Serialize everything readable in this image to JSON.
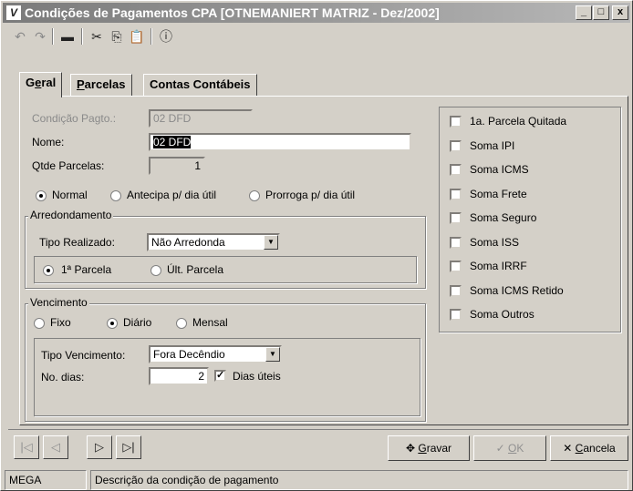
{
  "window": {
    "title": "Condições de Pagamentos CPA [OTNEMANIERT MATRIZ - Dez/2002]",
    "app_icon": "V",
    "min_icon": "_",
    "max_icon": "□",
    "close_icon": "x"
  },
  "toolbar": {
    "undo_icon": "↶",
    "redo_icon": "↷",
    "delete_icon": "▬",
    "cut_icon": "✂",
    "copy_icon": "⎘",
    "paste_icon": "📋",
    "info_icon": "ⓘ"
  },
  "tabs": {
    "geral_pre": "G",
    "geral_u": "e",
    "geral_post": "ral",
    "parcelas_u": "P",
    "parcelas_post": "arcelas",
    "contas": "Contas Contábeis"
  },
  "form": {
    "condicao_label": "Condição Pagto.:",
    "condicao_value": "02 DFD",
    "nome_label": "Nome:",
    "nome_value": "02 DFD",
    "qtde_label": "Qtde Parcelas:",
    "qtde_value": "1",
    "radio_normal": "Normal",
    "radio_antecipa": "Antecipa p/ dia útil",
    "radio_prorroga": "Prorroga p/ dia útil"
  },
  "arredondamento": {
    "title": "Arredondamento",
    "tipo_label": "Tipo Realizado:",
    "tipo_value": "Não Arredonda",
    "radio_primeira": "1ª Parcela",
    "radio_ultima": "Últ. Parcela"
  },
  "vencimento": {
    "title": "Vencimento",
    "radio_fixo": "Fixo",
    "radio_diario": "Diário",
    "radio_mensal": "Mensal",
    "tipo_label": "Tipo Vencimento:",
    "tipo_value": "Fora Decêndio",
    "dias_label": "No. dias:",
    "dias_value": "2",
    "dias_uteis_label": "Dias úteis"
  },
  "checks": [
    {
      "label": "1a. Parcela Quitada",
      "checked": false
    },
    {
      "label": "Soma IPI",
      "checked": false
    },
    {
      "label": "Soma ICMS",
      "checked": false
    },
    {
      "label": "Soma Frete",
      "checked": false
    },
    {
      "label": "Soma Seguro",
      "checked": false
    },
    {
      "label": "Soma ISS",
      "checked": false
    },
    {
      "label": "Soma IRRF",
      "checked": false
    },
    {
      "label": "Soma ICMS Retido",
      "checked": false
    },
    {
      "label": "Soma Outros",
      "checked": false
    }
  ],
  "nav": {
    "first_icon": "|◁",
    "prev_icon": "◁",
    "next_icon": "▷",
    "last_icon": "▷|"
  },
  "actions": {
    "gravar_icon": "✥",
    "gravar_u": "G",
    "gravar_post": "ravar",
    "ok_icon": "✓",
    "ok_u": "O",
    "ok_post": "K",
    "cancela_icon": "✕",
    "cancela_u": "C",
    "cancela_post": "ancela"
  },
  "status": {
    "left": "MEGA",
    "message": "Descrição da condição de pagamento"
  },
  "check_mark": "✓"
}
